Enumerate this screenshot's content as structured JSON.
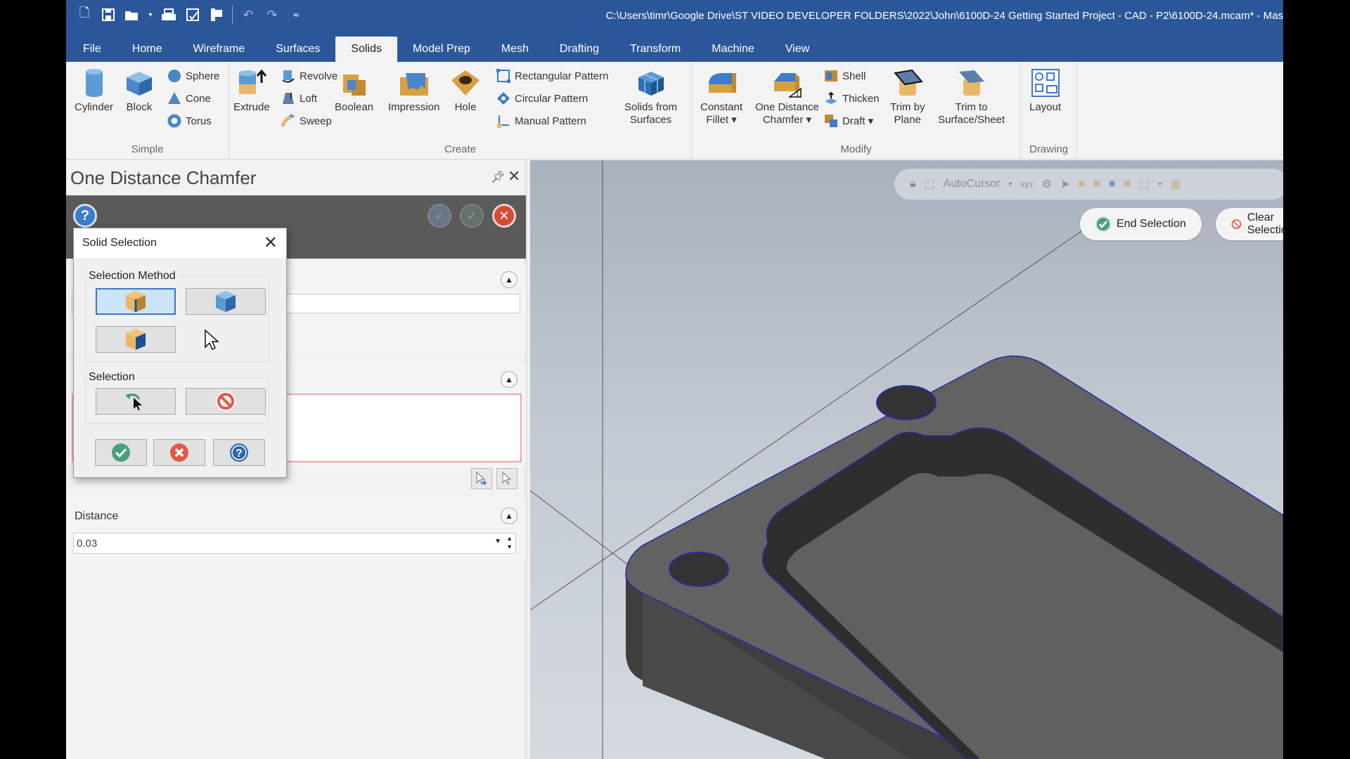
{
  "window": {
    "title": "C:\\Users\\timr\\Google Drive\\ST VIDEO DEVELOPER FOLDERS\\2022\\John\\6100D-24 Getting Started Project - CAD - P2\\6100D-24.mcam* - Mas"
  },
  "quick_access": [
    "new-file-icon",
    "save-icon",
    "open-icon",
    "print-icon",
    "save-as-icon",
    "export-icon",
    "undo-icon",
    "redo-icon",
    "customize-icon"
  ],
  "tabs": [
    {
      "label": "File"
    },
    {
      "label": "Home"
    },
    {
      "label": "Wireframe"
    },
    {
      "label": "Surfaces"
    },
    {
      "label": "Solids",
      "active": true
    },
    {
      "label": "Model Prep"
    },
    {
      "label": "Mesh"
    },
    {
      "label": "Drafting"
    },
    {
      "label": "Transform"
    },
    {
      "label": "Machine"
    },
    {
      "label": "View"
    }
  ],
  "ribbon": {
    "simple": {
      "label": "Simple",
      "cylinder": "Cylinder",
      "block": "Block",
      "sphere": "Sphere",
      "cone": "Cone",
      "torus": "Torus"
    },
    "create": {
      "label": "Create",
      "extrude": "Extrude",
      "revolve": "Revolve",
      "loft": "Loft",
      "sweep": "Sweep",
      "boolean": "Boolean",
      "impression": "Impression",
      "hole": "Hole",
      "rect_pattern": "Rectangular Pattern",
      "circ_pattern": "Circular Pattern",
      "manual_pattern": "Manual Pattern",
      "solids_from_surfaces_1": "Solids from",
      "solids_from_surfaces_2": "Surfaces"
    },
    "modify": {
      "label": "Modify",
      "constant_fillet_1": "Constant",
      "constant_fillet_2": "Fillet ▾",
      "one_dist_chamfer_1": "One Distance",
      "one_dist_chamfer_2": "Chamfer ▾",
      "shell": "Shell",
      "thicken": "Thicken",
      "draft": "Draft ▾",
      "trim_plane_1": "Trim by",
      "trim_plane_2": "Plane",
      "trim_surface_1": "Trim to",
      "trim_surface_2": "Surface/Sheet"
    },
    "drawing": {
      "label": "Drawing",
      "layout": "Layout"
    }
  },
  "panel": {
    "title": "One Distance Chamfer",
    "distance_label": "Distance",
    "distance_value": "0.03"
  },
  "dialog": {
    "title": "Solid Selection",
    "selection_method_label": "Selection Method",
    "selection_label": "Selection"
  },
  "viewport": {
    "autocursor_label": "AutoCursor",
    "end_selection": "End Selection",
    "clear_selection": "Clear Selection"
  },
  "colors": {
    "title_blue": "#2b579a",
    "selection_edge": "#2a2aa0",
    "part_gray": "#5f5f5f"
  }
}
